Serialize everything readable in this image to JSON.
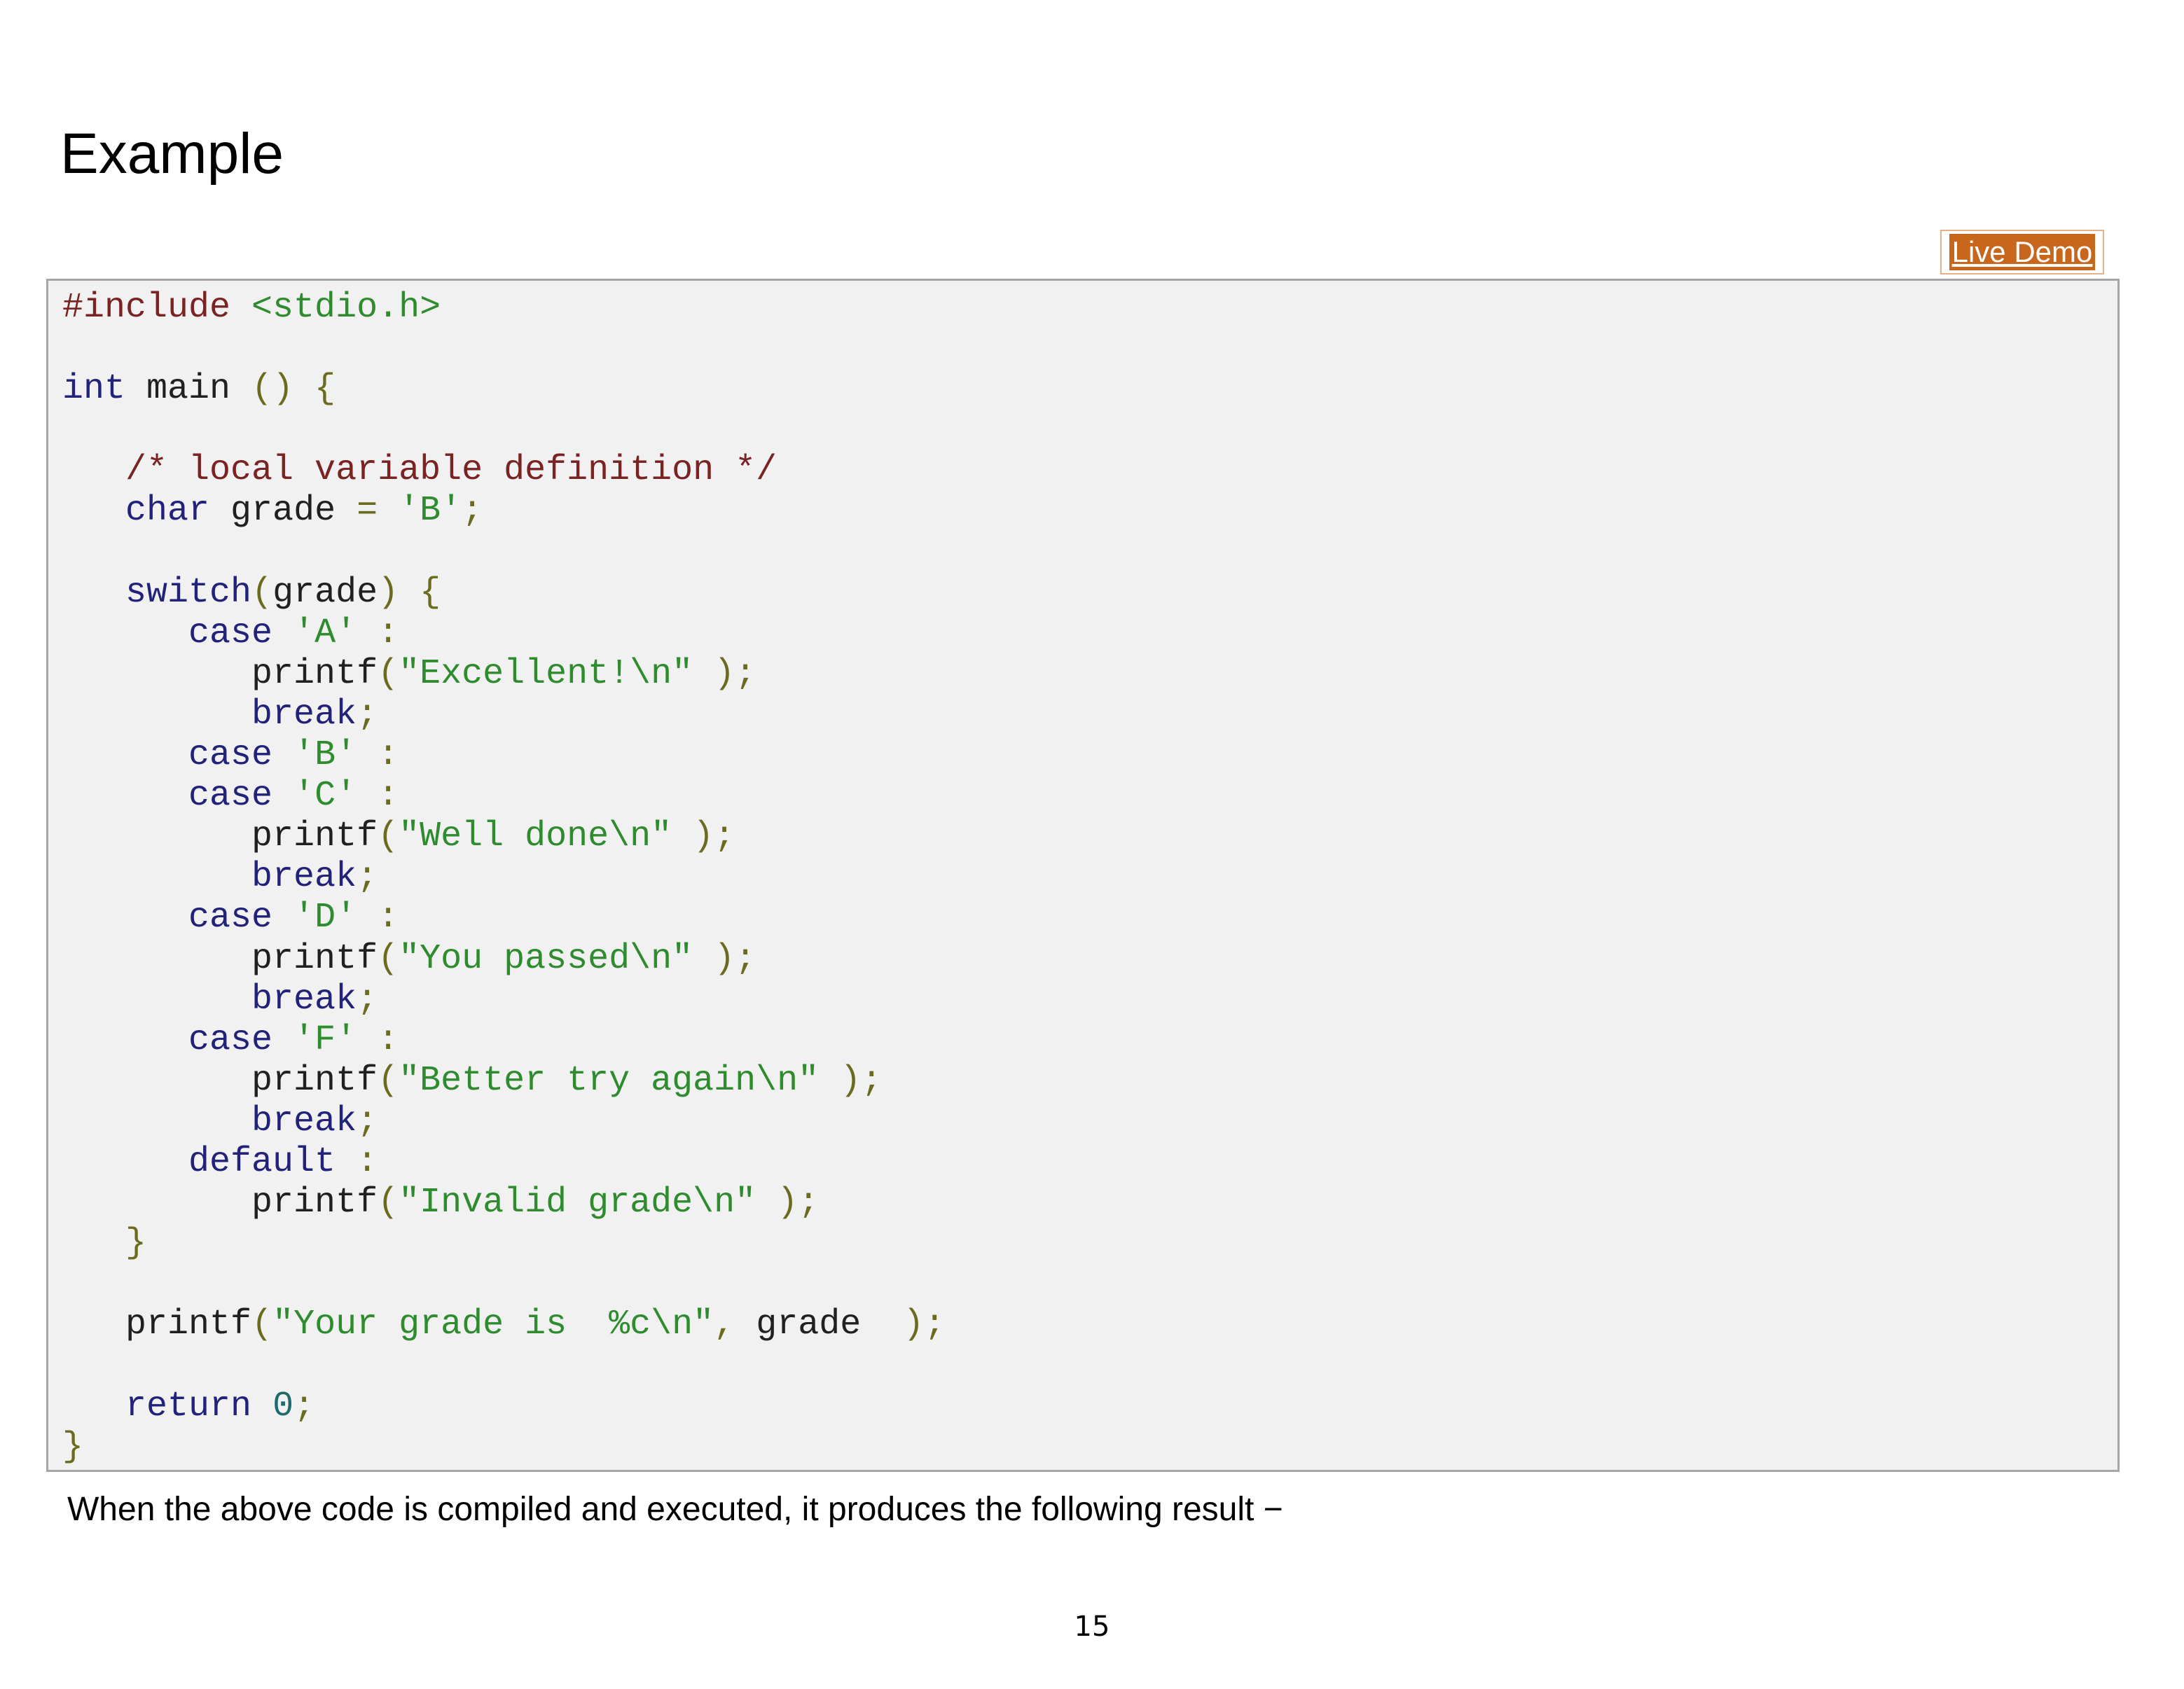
{
  "heading": "Example",
  "live_demo_label": "Live Demo",
  "code": {
    "l1a": "#include ",
    "l1b": "<stdio.h>",
    "l3a": "int",
    "l3b": " main ",
    "l3c": "() {",
    "l5a": "   ",
    "l5b": "/* local variable definition */",
    "l6a": "   ",
    "l6b": "char",
    "l6c": " grade ",
    "l6d": "=",
    "l6e": " ",
    "l6f": "'B'",
    "l6g": ";",
    "l8a": "   ",
    "l8b": "switch",
    "l8c": "(",
    "l8d": "grade",
    "l8e": ") {",
    "case_kw": "case",
    "break_kw": "break",
    "default_kw": "default",
    "printf": "printf",
    "colon": " :",
    "semi": ";",
    "open_paren": "(",
    "close_call": " );",
    "case_a": "'A'",
    "case_b": "'B'",
    "case_c": "'C'",
    "case_d": "'D'",
    "case_f": "'F'",
    "str_excellent": "\"Excellent!\\n\"",
    "str_welldone": "\"Well done\\n\"",
    "str_passed": "\"You passed\\n\"",
    "str_better": "\"Better try again\\n\"",
    "str_invalid": "\"Invalid grade\\n\"",
    "close_switch": "}",
    "str_yourgrade": "\"Your grade is  %c\\n\"",
    "comma": ",",
    "grade_arg": " grade ",
    "return_kw": "return",
    "zero": "0",
    "close_main": "}"
  },
  "result_text": "When the above code is compiled and executed, it produces the following result −",
  "page_number": "15",
  "colors": {
    "live_demo_bg": "#c8661b",
    "code_bg": "#f1f1f1",
    "keyword": "#22227a",
    "preprocessor": "#7a2323",
    "string": "#2e8b2e",
    "punctuation": "#6b6b1f"
  }
}
